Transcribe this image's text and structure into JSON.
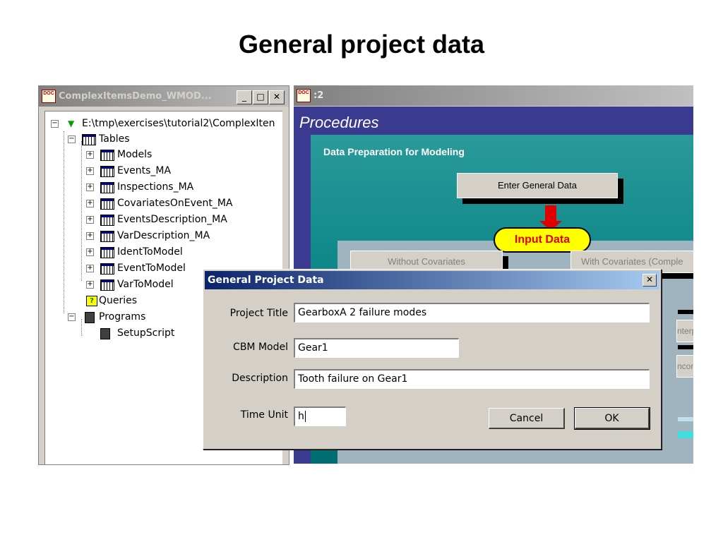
{
  "page": {
    "title": "General project data"
  },
  "left_window": {
    "title": "ComplexItemsDemo_WMOD...",
    "icon": "doc-icon",
    "buttons": {
      "minimize": "_",
      "maximize": "□",
      "close": "✕"
    },
    "tree": {
      "root": "E:\\tmp\\exercises\\tutorial2\\ComplexIten",
      "tables_label": "Tables",
      "tables": [
        "Models",
        "Events_MA",
        "Inspections_MA",
        "CovariatesOnEvent_MA",
        "EventsDescription_MA",
        "VarDescription_MA",
        "IdentToModel",
        "EventToModel",
        "VarToModel"
      ],
      "queries_label": "Queries",
      "programs_label": "Programs",
      "programs": [
        "SetupScript"
      ]
    }
  },
  "right_window": {
    "title": ":2",
    "procedures_title": "Procedures",
    "section_label": "Data Preparation for Modeling",
    "enter_general_label": "Enter General Data",
    "input_data_label": "Input Data",
    "without_covariates_label": "Without Covariates",
    "with_covariates_label": "With Covariates (Comple",
    "interpol_label": "nterpol",
    "incomp_label": "ncomp",
    "colors": {
      "accent": "#e00000",
      "pill": "#ffff00",
      "background": "#3a3a90",
      "panel": "#007e80"
    }
  },
  "dialog": {
    "title": "General Project Data",
    "close_label": "✕",
    "fields": {
      "project_title": {
        "label": "Project Title",
        "value": "GearboxA 2 failure modes"
      },
      "cbm_model": {
        "label": "CBM Model",
        "value": "Gear1"
      },
      "description": {
        "label": "Description",
        "value": "Tooth failure on Gear1"
      },
      "time_unit": {
        "label": "Time Unit",
        "value": "h"
      }
    },
    "cancel_label": "Cancel",
    "ok_label": "OK"
  }
}
